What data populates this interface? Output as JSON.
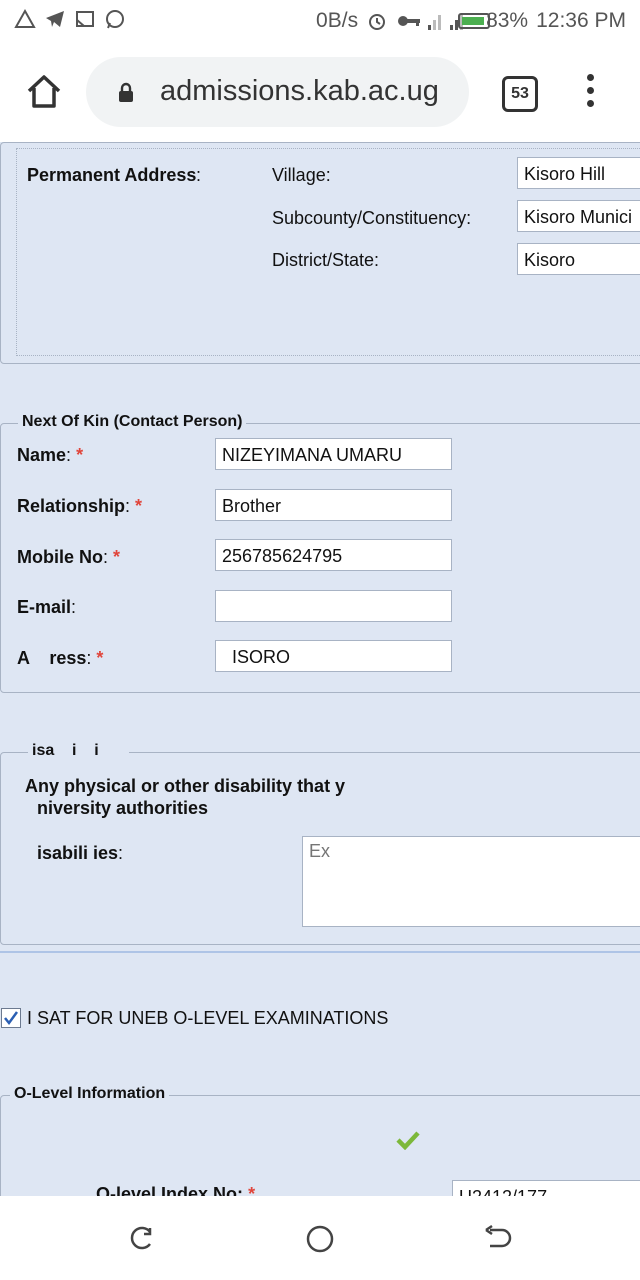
{
  "status": {
    "speed": "0B/s",
    "battery": "83%",
    "time": "12:36 PM"
  },
  "browser": {
    "url": "admissions.kab.ac.ug",
    "tab_count": "53"
  },
  "permanent_address": {
    "heading": "Permanent Address",
    "heading_colon": ":",
    "village_label": "Village:",
    "village_value": "Kisoro Hill",
    "subcounty_label": "Subcounty/Constituency:",
    "subcounty_value": "Kisoro Munici",
    "district_label": "District/State:",
    "district_value": "Kisoro"
  },
  "next_of_kin": {
    "legend": "Next Of Kin (Contact Person)",
    "name_label": "Name",
    "name_value": "NIZEYIMANA UMARU",
    "relationship_label": "Relationship",
    "relationship_value": "Brother",
    "mobile_label": "Mobile No",
    "mobile_value": "256785624795",
    "email_label": "E-mail",
    "email_value": "",
    "address_label": "A    ress",
    "address_value": "  ISORO",
    "colon": ":",
    "asterisk": "*"
  },
  "disability": {
    "legend": "isa    i    i",
    "question_line1": "Any physical or other disability that y",
    "question_line2": "niversity authorities",
    "label": "isabili ies",
    "colon": ":",
    "placeholder": "Ex"
  },
  "olevel": {
    "checkbox_label": "I SAT FOR UNEB O-LEVEL EXAMINATIONS",
    "checked": true,
    "legend": "O-Level Information",
    "index_label_partial": "O-level Index No:",
    "index_value_partial": "U2412/177"
  },
  "colors": {
    "page_bg": "#dee6f3",
    "required": "#e0453b",
    "check_green": "#7cb83a"
  }
}
